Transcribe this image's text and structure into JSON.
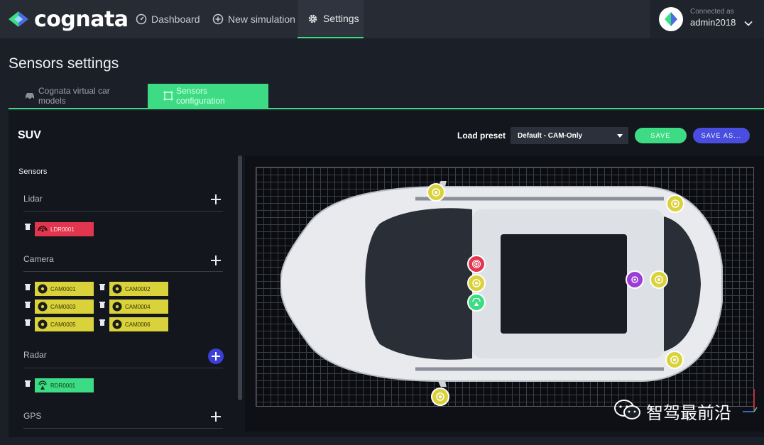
{
  "brand": {
    "name": "cognata"
  },
  "nav": {
    "items": [
      {
        "label": "Dashboard",
        "icon": "dashboard-icon"
      },
      {
        "label": "New simulation",
        "icon": "plus-circle-icon"
      },
      {
        "label": "Settings",
        "icon": "gear-icon",
        "active": true
      }
    ]
  },
  "user": {
    "connected_label": "Connected as",
    "name": "admin2018"
  },
  "page": {
    "title": "Sensors settings"
  },
  "tabs": [
    {
      "label": "Cognata virtual car models",
      "icon": "car-icon"
    },
    {
      "label": "Sensors configuration",
      "icon": "sensor-frame-icon",
      "active": true
    }
  ],
  "vehicle": {
    "name": "SUV"
  },
  "preset": {
    "label": "Load preset",
    "value": "Default - CAM-Only"
  },
  "actions": {
    "save": "SAVE",
    "save_as": "SAVE AS..."
  },
  "sensors": {
    "label": "Sensors",
    "sections": [
      {
        "title": "Lidar",
        "items": [
          "LDR0001"
        ]
      },
      {
        "title": "Camera",
        "items": [
          "CAM0001",
          "CAM0002",
          "CAM0003",
          "CAM0004",
          "CAM0005",
          "CAM0006"
        ]
      },
      {
        "title": "Radar",
        "items": [
          "RDR0001"
        ]
      },
      {
        "title": "GPS",
        "items": []
      }
    ]
  },
  "colors": {
    "accent_green": "#3ddc84",
    "accent_blue": "#4a4ee0",
    "lidar_red": "#e2364e",
    "camera_yellow": "#d9d23a",
    "gps_purple": "#9a3fd6"
  },
  "watermark": {
    "text": "智驾最前沿"
  }
}
